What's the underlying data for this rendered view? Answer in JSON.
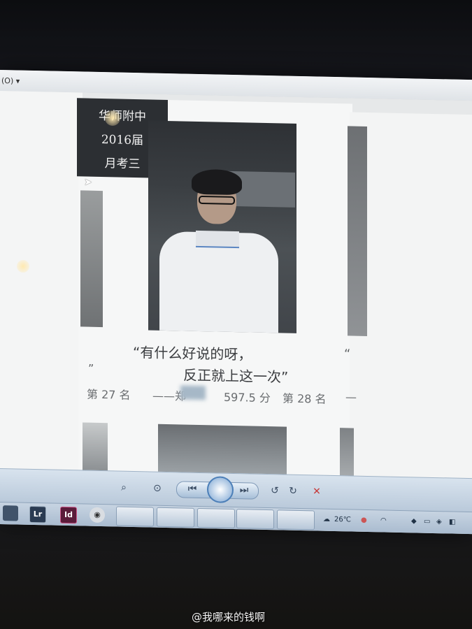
{
  "menu": {
    "label": "(O) ▾"
  },
  "label_box": {
    "line1": "华师附中",
    "line2": "2016届",
    "line3": "月考三"
  },
  "quote": {
    "line1": "“有什么好说的呀，",
    "line2": "反正就上这一次”",
    "open_right": "“",
    "close_left": "”"
  },
  "rank": {
    "left": "第 27 名",
    "dash_name": "——郑",
    "score": "597.5 分",
    "right": "第 28 名",
    "trail_dash": "—"
  },
  "viewer_toolbar": {
    "zoom_icon": "magnifier-icon",
    "fit_icon": "fit-icon",
    "prev_icon": "previous-icon",
    "slideshow_icon": "slideshow-icon",
    "next_icon": "next-icon",
    "rotate_ccw_icon": "rotate-left-icon",
    "rotate_cw_icon": "rotate-right-icon",
    "delete_icon": "delete-icon"
  },
  "taskbar": {
    "apps": [
      "Lr",
      "Id"
    ],
    "weather": "26℃",
    "colors": {
      "lightroom": "#2a3b52",
      "indesign": "#5a1c3a"
    }
  },
  "watermark": "@我哪来的钱啊"
}
